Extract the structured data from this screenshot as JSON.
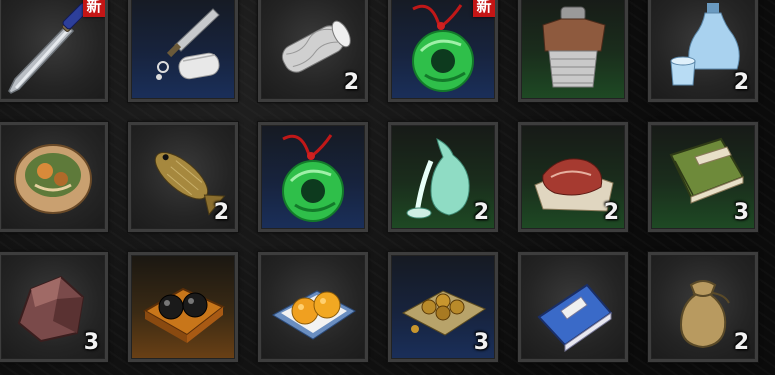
{
  "inventory": {
    "rows": [
      [
        {
          "icon": "sword-icon",
          "quality": "gray",
          "count": "",
          "badge": "新"
        },
        {
          "icon": "kunai-scroll-icon",
          "quality": "blue",
          "count": "",
          "badge": ""
        },
        {
          "icon": "cloth-roll-icon",
          "quality": "gray",
          "count": "2",
          "badge": ""
        },
        {
          "icon": "jade-pendant-icon",
          "quality": "blue",
          "count": "",
          "badge": "新"
        },
        {
          "icon": "chainmail-vest-icon",
          "quality": "green",
          "count": "",
          "badge": ""
        },
        {
          "icon": "sake-bottle-icon",
          "quality": "gray",
          "count": "2",
          "badge": ""
        }
      ],
      [
        {
          "icon": "dumpling-bowl-icon",
          "quality": "gray",
          "count": "",
          "badge": ""
        },
        {
          "icon": "fish-icon",
          "quality": "gray",
          "count": "2",
          "badge": ""
        },
        {
          "icon": "jade-pendant-icon",
          "quality": "blue",
          "count": "",
          "badge": ""
        },
        {
          "icon": "jade-vase-icon",
          "quality": "green",
          "count": "2",
          "badge": ""
        },
        {
          "icon": "meat-icon",
          "quality": "green",
          "count": "2",
          "badge": ""
        },
        {
          "icon": "green-book-icon",
          "quality": "green",
          "count": "3",
          "badge": ""
        }
      ],
      [
        {
          "icon": "ore-rock-icon",
          "quality": "gray",
          "count": "3",
          "badge": ""
        },
        {
          "icon": "black-pearls-icon",
          "quality": "orange",
          "count": "",
          "badge": ""
        },
        {
          "icon": "oranges-icon",
          "quality": "gray",
          "count": "",
          "badge": ""
        },
        {
          "icon": "golden-beads-icon",
          "quality": "blue",
          "count": "3",
          "badge": ""
        },
        {
          "icon": "blue-book-icon",
          "quality": "gray",
          "count": "",
          "badge": ""
        },
        {
          "icon": "pouch-icon",
          "quality": "gray",
          "count": "2",
          "badge": ""
        }
      ]
    ]
  }
}
